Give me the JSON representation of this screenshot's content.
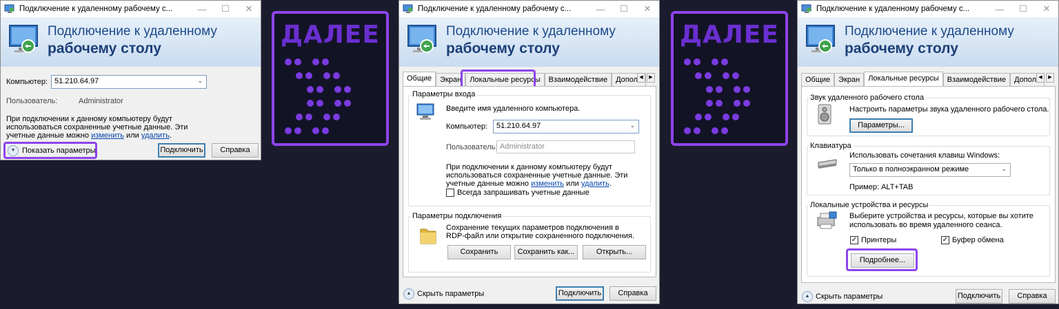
{
  "window_title": "Подключение к удаленному рабочему с...",
  "header_line1": "Подключение к удаленному",
  "header_line2": "рабочему столу",
  "win1": {
    "computer_label": "Компьютер:",
    "computer_value": "51.210.64.97",
    "user_label": "Пользователь:",
    "user_value": "Administrator",
    "info_line1": "При подключении к данному компьютеру будут",
    "info_line2": "использоваться сохраненные учетные данные.  Эти",
    "info_line3_prefix": "учетные данные можно",
    "info_link_change": "изменить",
    "info_or": "или",
    "info_link_delete": "удалить",
    "info_dot": ".",
    "show_params": "Показать параметры",
    "connect_button": "Подключить",
    "help_button": "Справка"
  },
  "banner_text": "ДАЛЕЕ",
  "win2": {
    "tabs": [
      "Общие",
      "Экран",
      "Локальные ресурсы",
      "Взаимодействие",
      "Дополни"
    ],
    "login_group_title": "Параметры входа",
    "enter_name": "Введите имя удаленного компьютера.",
    "computer_label": "Компьютер:",
    "computer_value": "51.210.64.97",
    "user_label": "Пользователь:",
    "user_placeholder": "Administrator",
    "info_line1": "При подключении к данному компьютеру будут",
    "info_line2": "использоваться сохраненные учетные данные.  Эти",
    "info_line3_prefix": "учетные данные можно",
    "info_link_change": "изменить",
    "info_or": "или",
    "info_link_delete": "удалить",
    "info_dot": ".",
    "always_ask": "Всегда запрашивать учетные данные",
    "conn_group_title": "Параметры подключения",
    "conn_line1": "Сохранение текущих параметров подключения в",
    "conn_line2": "RDP-файл или открытие сохраненного подключения.",
    "save_button": "Сохранить",
    "save_as_button": "Сохранить как...",
    "open_button": "Открыть...",
    "hide_params": "Скрыть параметры",
    "connect_button": "Подключить",
    "help_button": "Справка"
  },
  "win3": {
    "tabs": [
      "Общие",
      "Экран",
      "Локальные ресурсы",
      "Взаимодействие",
      "Дополни"
    ],
    "sound_group_title": "Звук удаленного рабочего стола",
    "sound_text": "Настроить параметры звука удаленного рабочего стола.",
    "params_button": "Параметры...",
    "keyboard_group_title": "Клавиатура",
    "keyboard_text": "Использовать сочетания клавиш Windows:",
    "keyboard_select": "Только в полноэкранном режиме",
    "example": "Пример: ALT+TAB",
    "devices_group_title": "Локальные устройства и ресурсы",
    "devices_line1": "Выберите устройства и ресурсы, которые вы хотите",
    "devices_line2": "использовать во время удаленного сеанса.",
    "printers": "Принтеры",
    "clipboard": "Буфер обмена",
    "more_button": "Подробнее...",
    "hide_params": "Скрыть параметры",
    "connect_button": "Подключить",
    "help_button": "Справка"
  },
  "colors": {
    "highlight": "#8e44ec",
    "header_text": "#1c4a8c",
    "banner_bg": "#131326"
  }
}
